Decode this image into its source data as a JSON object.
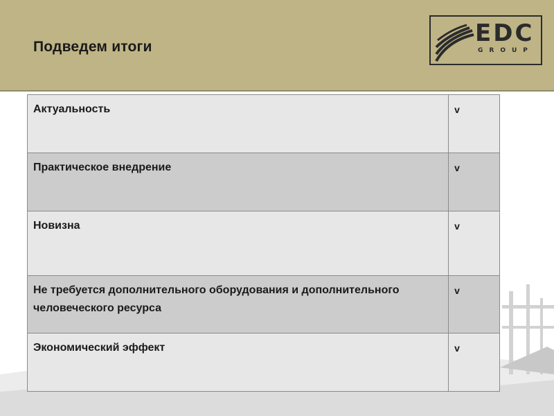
{
  "slide": {
    "title": "Подведем итоги"
  },
  "logo": {
    "name": "EDC",
    "sub": "GROUP"
  },
  "summary": {
    "rows": [
      {
        "label": "Актуальность",
        "mark": "v"
      },
      {
        "label": "Практическое внедрение",
        "mark": "v"
      },
      {
        "label": "Новизна",
        "mark": "v"
      },
      {
        "label": "Не требуется дополнительного оборудования и дополнительного человеческого ресурса",
        "mark": "v"
      },
      {
        "label": "Экономический эффект",
        "mark": "v"
      }
    ]
  },
  "colors": {
    "header_bg": "#bfb486",
    "row_light": "#e7e7e7",
    "row_dark": "#cccccc"
  }
}
